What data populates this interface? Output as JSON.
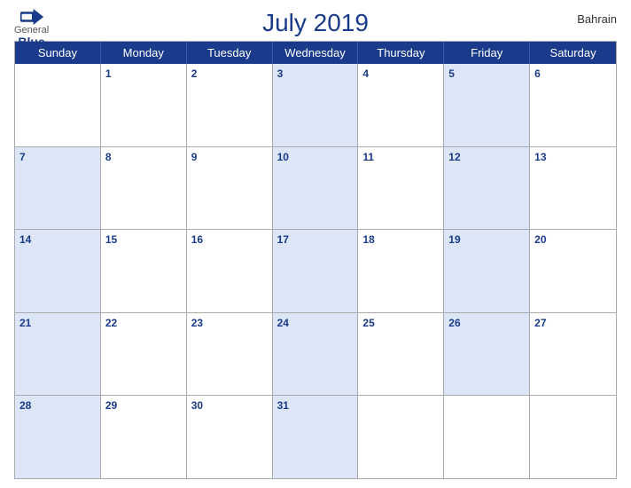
{
  "header": {
    "title": "July 2019",
    "country": "Bahrain",
    "logo": {
      "general": "General",
      "blue": "Blue"
    }
  },
  "days_of_week": [
    "Sunday",
    "Monday",
    "Tuesday",
    "Wednesday",
    "Thursday",
    "Friday",
    "Saturday"
  ],
  "weeks": [
    [
      {
        "num": "",
        "blue": false
      },
      {
        "num": "1",
        "blue": false
      },
      {
        "num": "2",
        "blue": false
      },
      {
        "num": "3",
        "blue": true
      },
      {
        "num": "4",
        "blue": false
      },
      {
        "num": "5",
        "blue": true
      },
      {
        "num": "6",
        "blue": false
      }
    ],
    [
      {
        "num": "7",
        "blue": true
      },
      {
        "num": "8",
        "blue": false
      },
      {
        "num": "9",
        "blue": false
      },
      {
        "num": "10",
        "blue": true
      },
      {
        "num": "11",
        "blue": false
      },
      {
        "num": "12",
        "blue": true
      },
      {
        "num": "13",
        "blue": false
      }
    ],
    [
      {
        "num": "14",
        "blue": true
      },
      {
        "num": "15",
        "blue": false
      },
      {
        "num": "16",
        "blue": false
      },
      {
        "num": "17",
        "blue": true
      },
      {
        "num": "18",
        "blue": false
      },
      {
        "num": "19",
        "blue": true
      },
      {
        "num": "20",
        "blue": false
      }
    ],
    [
      {
        "num": "21",
        "blue": true
      },
      {
        "num": "22",
        "blue": false
      },
      {
        "num": "23",
        "blue": false
      },
      {
        "num": "24",
        "blue": true
      },
      {
        "num": "25",
        "blue": false
      },
      {
        "num": "26",
        "blue": true
      },
      {
        "num": "27",
        "blue": false
      }
    ],
    [
      {
        "num": "28",
        "blue": true
      },
      {
        "num": "29",
        "blue": false
      },
      {
        "num": "30",
        "blue": false
      },
      {
        "num": "31",
        "blue": true
      },
      {
        "num": "",
        "blue": false
      },
      {
        "num": "",
        "blue": false
      },
      {
        "num": "",
        "blue": false
      }
    ]
  ]
}
